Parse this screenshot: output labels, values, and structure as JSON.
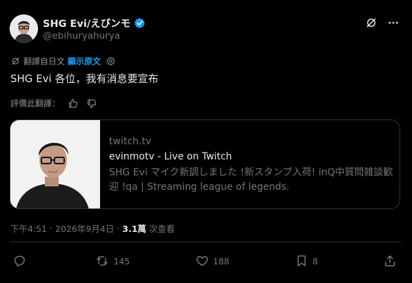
{
  "author": {
    "display_name": "SHG Evi/えびンモ",
    "handle": "@ebihuryahurya"
  },
  "translation": {
    "label": "翻譯自日文",
    "show_original": "顯示原文"
  },
  "tweet": {
    "text": "SHG Evi  各位，我有消息要宣布"
  },
  "rating": {
    "label": "評價此翻譯："
  },
  "card": {
    "domain": "twitch.tv",
    "title": "evinmotv - Live on Twitch",
    "description": "SHG Evi マイク新調しました !新スタンプ入荷! inQ中質問雑談歓迎 !qa | Streaming league of legends."
  },
  "meta": {
    "time": "下午4:51",
    "separator": "·",
    "date": "2026年9月4日",
    "views": "3.1萬",
    "views_label": "次查看"
  },
  "actions": {
    "reply_count": "",
    "retweet_count": "145",
    "like_count": "188",
    "bookmark_count": "8"
  },
  "colors": {
    "background": "#000000",
    "accent": "#1d9bf0",
    "text": "#e7e9ea",
    "muted": "#71767b"
  }
}
